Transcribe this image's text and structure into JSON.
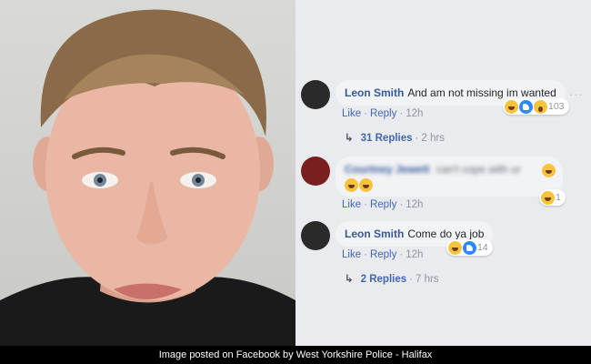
{
  "caption": "Image posted on Facebook by West Yorkshire Police - Halifax",
  "comments": [
    {
      "author": "Leon Smith",
      "text": "And am not missing im wanted",
      "like": "Like",
      "reply": "Reply",
      "time": "12h",
      "reaction_count": "103",
      "reactions": [
        "haha-icon",
        "like-icon",
        "wow-icon"
      ],
      "replies_label": "31 Replies",
      "replies_time": "2 hrs"
    },
    {
      "author": "Courtney Jewett",
      "text": "can't cope with ur",
      "like": "Like",
      "reply": "Reply",
      "time": "12h",
      "reaction_count": "1",
      "reactions": [
        "haha-icon"
      ]
    },
    {
      "author": "Leon Smith",
      "text": "Come do ya job",
      "like": "Like",
      "reply": "Reply",
      "time": "12h",
      "reaction_count": "14",
      "reactions": [
        "haha-icon",
        "like-icon"
      ],
      "replies_label": "2 Replies",
      "replies_time": "7 hrs"
    }
  ],
  "menu_glyph": "···",
  "separator": "·",
  "reply_arrow": "↳"
}
